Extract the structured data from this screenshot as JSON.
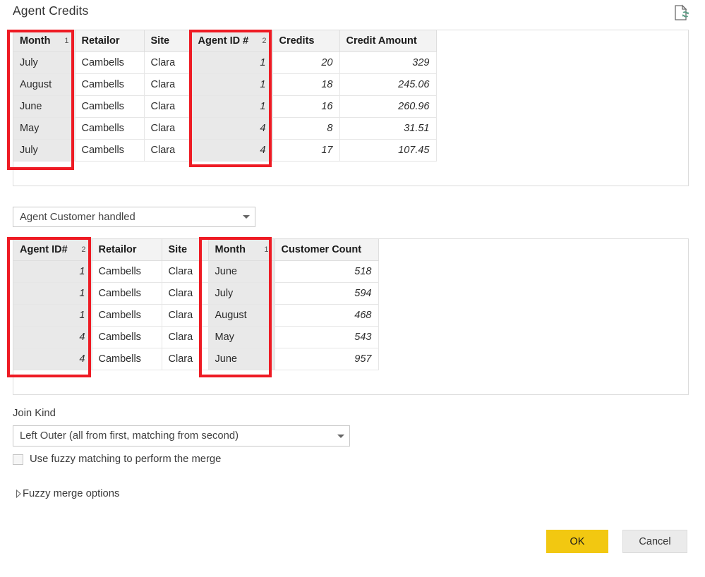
{
  "dialog": {
    "title": "Agent Credits",
    "refresh_icon": "refresh-document-icon"
  },
  "table_top": {
    "name": "Agent Credits preview",
    "columns": [
      {
        "label": "Month",
        "sort_order": "1",
        "highlighted": true,
        "align": "left"
      },
      {
        "label": "Retailor",
        "sort_order": "",
        "highlighted": false,
        "align": "left"
      },
      {
        "label": "Site",
        "sort_order": "",
        "highlighted": false,
        "align": "left"
      },
      {
        "label": "Agent ID #",
        "sort_order": "2",
        "highlighted": true,
        "align": "right"
      },
      {
        "label": "Credits",
        "sort_order": "",
        "highlighted": false,
        "align": "right"
      },
      {
        "label": "Credit Amount",
        "sort_order": "",
        "highlighted": false,
        "align": "right"
      }
    ],
    "rows": [
      [
        "July",
        "Cambells",
        "Clara",
        "1",
        "20",
        "329"
      ],
      [
        "August",
        "Cambells",
        "Clara",
        "1",
        "18",
        "245.06"
      ],
      [
        "June",
        "Cambells",
        "Clara",
        "1",
        "16",
        "260.96"
      ],
      [
        "May",
        "Cambells",
        "Clara",
        "4",
        "8",
        "31.51"
      ],
      [
        "July",
        "Cambells",
        "Clara",
        "4",
        "17",
        "107.45"
      ]
    ]
  },
  "table_select": {
    "value": "Agent Customer handled",
    "arrow_icon": "chevron-down-icon"
  },
  "table_bottom": {
    "name": "Agent Customer handled preview",
    "columns": [
      {
        "label": "Agent ID#",
        "sort_order": "2",
        "highlighted": true,
        "align": "right"
      },
      {
        "label": "Retailor",
        "sort_order": "",
        "highlighted": false,
        "align": "left"
      },
      {
        "label": "Site",
        "sort_order": "",
        "highlighted": false,
        "align": "left"
      },
      {
        "label": "Month",
        "sort_order": "1",
        "highlighted": true,
        "align": "left"
      },
      {
        "label": "Customer Count",
        "sort_order": "",
        "highlighted": false,
        "align": "right"
      }
    ],
    "rows": [
      [
        "1",
        "Cambells",
        "Clara",
        "June",
        "518"
      ],
      [
        "1",
        "Cambells",
        "Clara",
        "July",
        "594"
      ],
      [
        "1",
        "Cambells",
        "Clara",
        "August",
        "468"
      ],
      [
        "4",
        "Cambells",
        "Clara",
        "May",
        "543"
      ],
      [
        "4",
        "Cambells",
        "Clara",
        "June",
        "957"
      ]
    ]
  },
  "join_kind": {
    "label": "Join Kind",
    "value": "Left Outer (all from first, matching from second)",
    "arrow_icon": "chevron-down-icon"
  },
  "fuzzy_checkbox": {
    "label": "Use fuzzy matching to perform the merge",
    "checked": false
  },
  "fuzzy_expander": {
    "label": "Fuzzy merge options",
    "expanded": false,
    "icon": "triangle-right-icon"
  },
  "buttons": {
    "ok": "OK",
    "cancel": "Cancel"
  },
  "colors": {
    "accent_ok": "#f2c811",
    "annotation": "#ee1b24",
    "header_bg": "#f3f3f3",
    "sort_col_bg": "#e9e9e9"
  }
}
